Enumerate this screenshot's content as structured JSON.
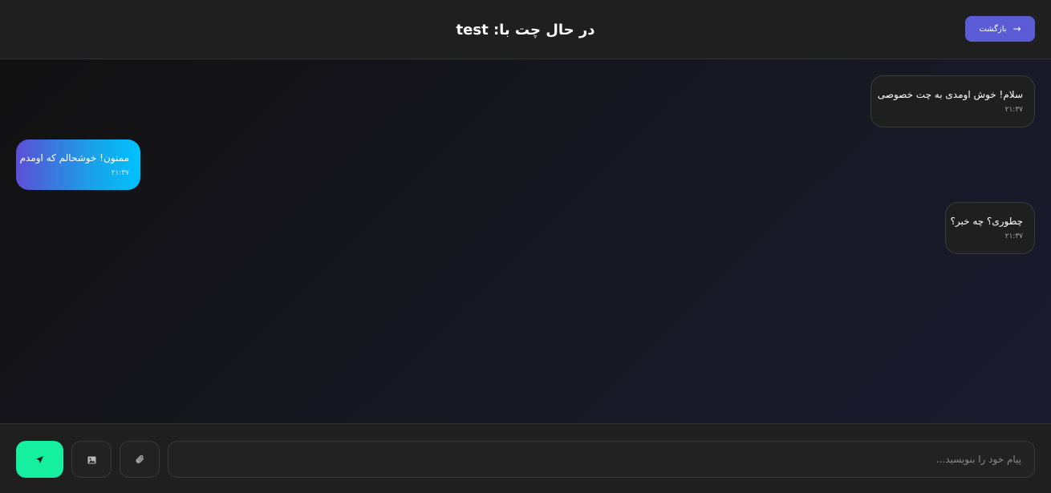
{
  "header": {
    "title": "در حال چت با: test",
    "back_label": "بازگشت",
    "back_icon": "arrow-right-icon"
  },
  "messages": [
    {
      "side": "received",
      "text": "سلام! خوش اومدی به چت خصوصی",
      "time": "۲۱:۳۷"
    },
    {
      "side": "sent",
      "text": "ممنون! خوشحالم که اومدم",
      "time": "۲۱:۳۷"
    },
    {
      "side": "received",
      "text": "چطوری؟ چه خبر؟",
      "time": "۲۱:۳۷"
    }
  ],
  "composer": {
    "placeholder": "پیام خود را بنویسید...",
    "value": "",
    "attach_icon": "paperclip-icon",
    "image_icon": "image-icon",
    "send_icon": "send-icon"
  },
  "colors": {
    "accent": "#5b5bd6",
    "send": "#14f0a0",
    "sent_bubble_start": "#5b4fd6",
    "sent_bubble_end": "#00c2ff"
  }
}
